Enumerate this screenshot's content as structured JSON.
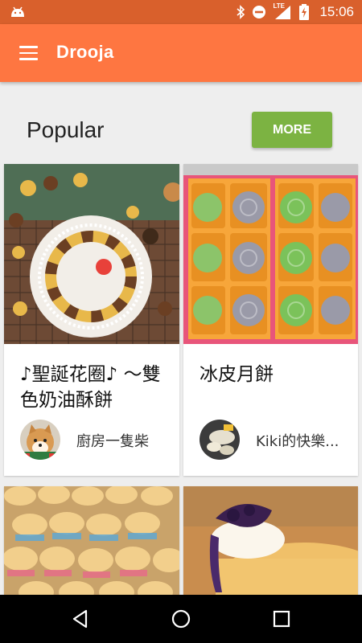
{
  "status_bar": {
    "time": "15:06",
    "icons": [
      "android-icon",
      "bluetooth-icon",
      "do-not-disturb-icon",
      "lte-signal-icon",
      "battery-charging-icon"
    ],
    "network_label": "LTE",
    "color": "#d9602c"
  },
  "toolbar": {
    "title": "Drooja",
    "menu_icon": "hamburger-menu-icon",
    "color": "#fe7641"
  },
  "section": {
    "title": "Popular",
    "more_label": "MORE",
    "more_color": "#7cb342"
  },
  "cards": [
    {
      "title": "♪聖誕花圈♪ 〜雙色奶油酥餅",
      "author": "廚房一隻柴",
      "image": "christmas-wreath-cookies-photo",
      "avatar": "shiba-dog-avatar"
    },
    {
      "title": "冰皮月餅",
      "author": "Kiki的快樂...",
      "image": "snowskin-mooncakes-photo",
      "avatar": "mooncake-avatar"
    },
    {
      "title": "",
      "author": "",
      "image": "cupcakes-photo"
    },
    {
      "title": "",
      "author": "",
      "image": "blueberry-cream-cake-photo"
    }
  ],
  "nav_bar": {
    "icons": [
      "back-icon",
      "home-icon",
      "recents-icon"
    ]
  }
}
